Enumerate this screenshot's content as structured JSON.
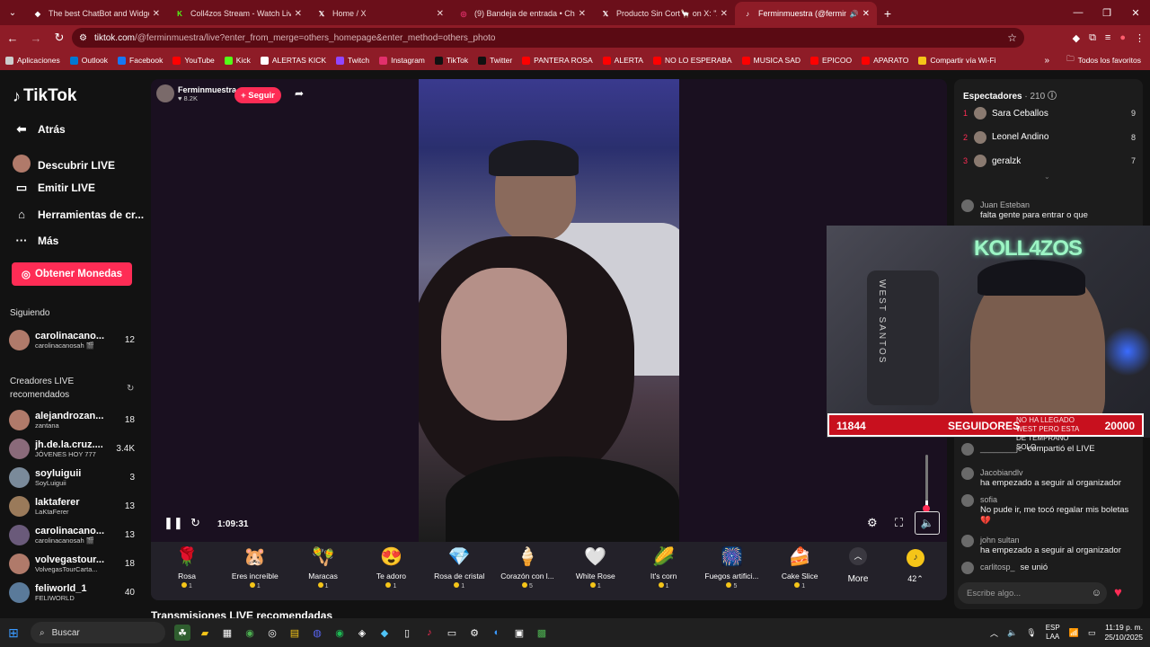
{
  "browser": {
    "tabs": [
      {
        "title": "The best ChatBot and Widgets",
        "icon": "shield-icon",
        "color": "#ffffff"
      },
      {
        "title": "Coll4zos Stream - Watch Live o",
        "icon": "kick-icon",
        "color": "#53fc18"
      },
      {
        "title": "Home / X",
        "icon": "x-icon",
        "color": "#ffffff"
      },
      {
        "title": "(9) Bandeja de entrada • Chats",
        "icon": "instagram-icon",
        "color": "#e1306c"
      },
      {
        "title": "Producto Sin Cort🦙 on X: \"Aqu",
        "icon": "x-icon",
        "color": "#ffffff"
      },
      {
        "title": "Ferminmuestra (@ferminm",
        "icon": "tiktok-icon",
        "color": "#ffffff",
        "active": true
      }
    ],
    "url_host": "tiktok.com",
    "url_path": "/@ferminmuestra/live?enter_from_merge=others_homepage&enter_method=others_photo",
    "bookmarks": [
      {
        "label": "Aplicaciones",
        "color": "#cccccc"
      },
      {
        "label": "Outlook",
        "color": "#0078d4"
      },
      {
        "label": "Facebook",
        "color": "#1877f2"
      },
      {
        "label": "YouTube",
        "color": "#ff0000"
      },
      {
        "label": "Kick",
        "color": "#53fc18"
      },
      {
        "label": "ALERTAS KICK",
        "color": "#ffffff"
      },
      {
        "label": "Twitch",
        "color": "#9146ff"
      },
      {
        "label": "Instagram",
        "color": "#e1306c"
      },
      {
        "label": "TikTok",
        "color": "#111111"
      },
      {
        "label": "Twitter",
        "color": "#111111"
      },
      {
        "label": "PANTERA ROSA",
        "color": "#ff0000"
      },
      {
        "label": "ALERTA",
        "color": "#ff0000"
      },
      {
        "label": "NO LO ESPERABA",
        "color": "#ff0000"
      },
      {
        "label": "MUSICA SAD",
        "color": "#ff0000"
      },
      {
        "label": "EPICOO",
        "color": "#ff0000"
      },
      {
        "label": "APARATO",
        "color": "#ff0000"
      },
      {
        "label": "Compartir vía Wi-Fi",
        "color": "#f5c518"
      }
    ],
    "all_bookmarks": "Todos los favoritos"
  },
  "sidebar": {
    "logo": "TikTok",
    "nav": [
      {
        "label": "Atrás",
        "icon": "back-arrow-icon"
      },
      {
        "label": "Descubrir LIVE",
        "icon": "live-avatar-icon"
      },
      {
        "label": "Emitir LIVE",
        "icon": "camera-icon"
      },
      {
        "label": "Herramientas de cr...",
        "icon": "lightbulb-icon"
      },
      {
        "label": "Más",
        "icon": "more-dots-icon"
      }
    ],
    "coins_button": "Obtener Monedas",
    "following_label": "Siguiendo",
    "following": [
      {
        "name": "carolinacano...",
        "sub": "carolinacanosah 🎬",
        "count": "12"
      }
    ],
    "recommended_label": "Creadores LIVE recomendados",
    "recommended": [
      {
        "name": "alejandrozan...",
        "sub": "zantana",
        "count": "18"
      },
      {
        "name": "jh.de.la.cruz....",
        "sub": "JÓVENES HOY 777",
        "count": "3.4K"
      },
      {
        "name": "soyluiguii",
        "sub": "SoyLuiguii",
        "count": "3"
      },
      {
        "name": "laktaferer",
        "sub": "LaKtaFerer",
        "count": "13"
      },
      {
        "name": "carolinacano...",
        "sub": "carolinacanosah 🎬",
        "count": "13"
      },
      {
        "name": "volvegastour...",
        "sub": "VolvegasTourCarta...",
        "count": "18"
      },
      {
        "name": "feliworld_1",
        "sub": "FELIWORLD",
        "count": "40"
      }
    ]
  },
  "player": {
    "host_name": "Ferminmuestra",
    "host_likes": "♥ 8.2K",
    "follow_label": "+ Seguir",
    "time": "1:09:31",
    "volume_level": 0.15
  },
  "gifts": [
    {
      "name": "Rosa",
      "price": "1",
      "icon": "🌹"
    },
    {
      "name": "Eres increíble",
      "price": "1",
      "icon": "🐹"
    },
    {
      "name": "Maracas",
      "price": "1",
      "icon": "🪇"
    },
    {
      "name": "Te adoro",
      "price": "1",
      "icon": "😍"
    },
    {
      "name": "Rosa de cristal",
      "price": "1",
      "icon": "💎"
    },
    {
      "name": "Corazón con l...",
      "price": "5",
      "icon": "🍦"
    },
    {
      "name": "White Rose",
      "price": "1",
      "icon": "🤍"
    },
    {
      "name": "It's corn",
      "price": "1",
      "icon": "🌽"
    },
    {
      "name": "Fuegos artifici...",
      "price": "5",
      "icon": "🎆"
    },
    {
      "name": "Cake Slice",
      "price": "1",
      "icon": "🍰"
    }
  ],
  "more_label": "More",
  "coin_balance": "42",
  "recs_title": "Transmisiones LIVE recomendadas",
  "viewers": {
    "title": "Espectadores",
    "count": "· 210",
    "list": [
      {
        "rank": "1",
        "name": "Sara Ceballos",
        "score": "9"
      },
      {
        "rank": "2",
        "name": "Leonel Andino",
        "score": "8"
      },
      {
        "rank": "3",
        "name": "geralzk",
        "score": "7"
      }
    ]
  },
  "chat": [
    {
      "user": "Juan Esteban",
      "text": "falta gente para entrar o que"
    },
    {
      "user": "________jc",
      "text": "compartió el LIVE"
    },
    {
      "user": "Jacobiandlv",
      "text": "ha empezado a seguir al organizador"
    },
    {
      "user": "sofia",
      "text": "No pude ir, me tocó regalar mis boletas 💔"
    },
    {
      "user": "john sultan",
      "text": "ha empezado a seguir al organizador"
    },
    {
      "user": "carlitosp_",
      "text": "se unió"
    }
  ],
  "chat_placeholder": "Escribe algo...",
  "overlay": {
    "neon_text": "KOLL4ZOS",
    "chair_text": "WEST SANTOS",
    "followers_current": "11844",
    "followers_label": "SEGUIDORES",
    "followers_goal": "20000",
    "tip_text": "NO HA LLEGADO WEST PERO ESTA DE TEMPRANO SOLO"
  },
  "taskbar": {
    "search": "Buscar",
    "lang1": "ESP",
    "lang2": "LAA",
    "time": "11:19 p. m.",
    "date": "25/10/2025"
  }
}
